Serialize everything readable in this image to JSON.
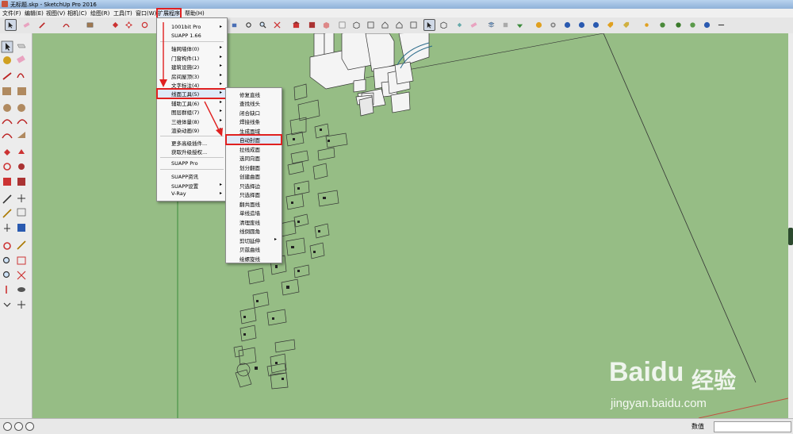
{
  "window": {
    "title": "无标题.skp - SketchUp Pro 2016"
  },
  "menubar": {
    "items": [
      "文件(F)",
      "编辑(E)",
      "视图(V)",
      "相机(C)",
      "绘图(R)",
      "工具(T)",
      "窗口(W)",
      "扩展程序",
      "帮助(H)"
    ],
    "highlighted": "扩展程序"
  },
  "extensions_menu": {
    "items": [
      "1001bit Pro",
      "SUAPP 1.66",
      "轴网墙体(0)",
      "门窗构件(1)",
      "建筑设施(2)",
      "房间屋顶(3)",
      "文字标注(4)",
      "线面工具(5)",
      "辅助工具(6)",
      "图层群组(7)",
      "三维体量(8)",
      "渲染动画(9)",
      "更多高级插件...",
      "获取升级授权...",
      "SUAPP Pro",
      "SUAPP资讯",
      "SUAPP设置",
      "V-Ray"
    ],
    "highlighted": "线面工具(5)"
  },
  "line_face_submenu": {
    "items": [
      "修复直线",
      "查找线头",
      "闭合缺口",
      "焊接线条",
      "生成面域",
      "自动封面",
      "拉线成面",
      "选同向面",
      "划分翻面",
      "创建曲面",
      "只选择边",
      "只选择面",
      "翻共面线",
      "单线造墙",
      "清理废线",
      "线倒圆角",
      "剪切延伸",
      "贝兹曲线",
      "绘螺旋线"
    ],
    "highlighted": "自动封面"
  },
  "statusbar": {
    "value_label": "数值",
    "value": ""
  },
  "watermark": {
    "brand": "Baidu",
    "sub": "经验",
    "url": "jingyan.baidu.com"
  },
  "colors": {
    "viewport": "#96bd85",
    "highlight": "#e02020",
    "toolbar": "#e6e6e6"
  },
  "icons": {
    "toolbar": [
      "select-icon",
      "eraser-icon",
      "pencil-icon",
      "arc-icon",
      "rectangle-icon",
      "push-pull-icon",
      "move-icon",
      "rotate-icon",
      "scale-icon",
      "paint-icon",
      "tape-icon",
      "orbit-icon",
      "pan-icon",
      "zoom-icon",
      "zoom-extents-icon",
      "warehouse-icon",
      "extension-icon",
      "component-icon",
      "house-icon",
      "iso-icon",
      "top-icon",
      "front-icon"
    ]
  }
}
